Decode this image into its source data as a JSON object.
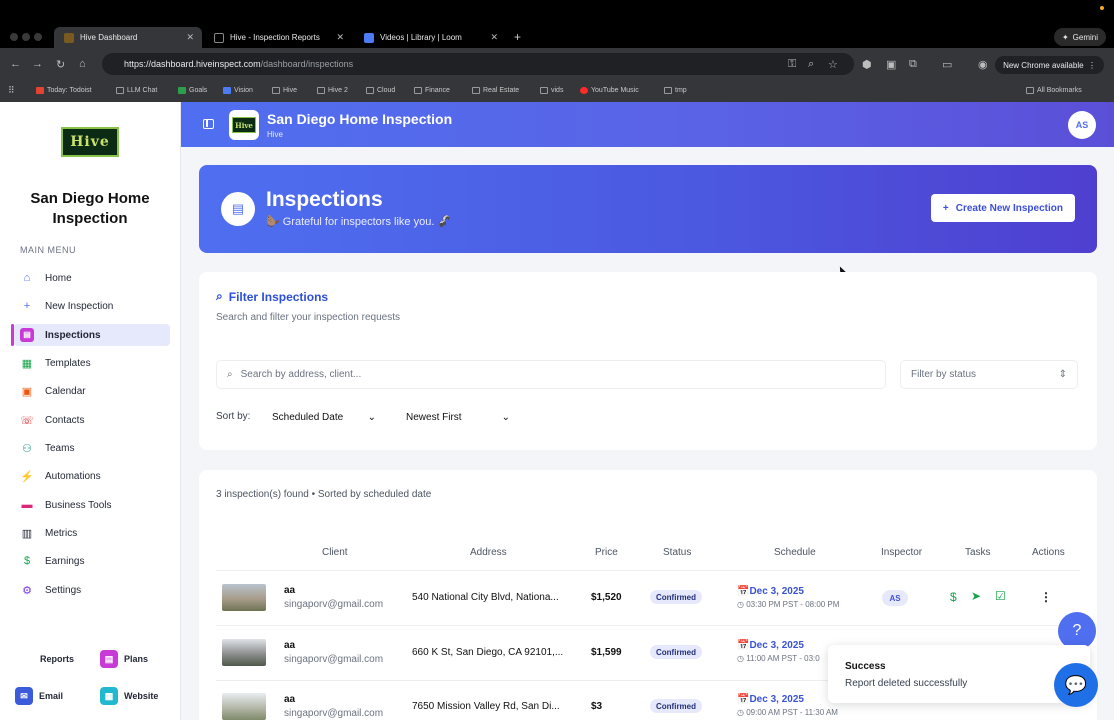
{
  "browser": {
    "tabs": [
      {
        "label": "Hive Dashboard",
        "active": true
      },
      {
        "label": "Hive - Inspection Reports",
        "active": false
      },
      {
        "label": "Videos | Library | Loom",
        "active": false
      }
    ],
    "url_host": "https://dashboard.hiveinspect.com",
    "url_path": "/dashboard/inspections",
    "gemini_label": "Gemini",
    "new_chrome_label": "New Chrome available",
    "bookmarks": [
      "Today: Todoist",
      "LLM Chat",
      "Goals",
      "Vision",
      "Hive",
      "Hive 2",
      "Cloud",
      "Finance",
      "Real Estate",
      "vids",
      "YouTube Music",
      "tmp"
    ],
    "all_bookmarks": "All Bookmarks"
  },
  "sidebar": {
    "logo_text": "Hive",
    "company": "San Diego Home Inspection",
    "menu_title": "MAIN MENU",
    "items": [
      {
        "label": "Home",
        "icon": "home-icon"
      },
      {
        "label": "New Inspection",
        "icon": "plus-icon"
      },
      {
        "label": "Inspections",
        "icon": "document-icon",
        "active": true
      },
      {
        "label": "Templates",
        "icon": "template-icon"
      },
      {
        "label": "Calendar",
        "icon": "calendar-icon"
      },
      {
        "label": "Contacts",
        "icon": "contacts-icon"
      },
      {
        "label": "Teams",
        "icon": "teams-icon"
      },
      {
        "label": "Automations",
        "icon": "lightning-icon"
      },
      {
        "label": "Business Tools",
        "icon": "briefcase-icon"
      },
      {
        "label": "Metrics",
        "icon": "chart-icon"
      },
      {
        "label": "Earnings",
        "icon": "dollar-icon"
      },
      {
        "label": "Settings",
        "icon": "gear-icon"
      }
    ],
    "bottom": {
      "reports": "Reports",
      "plans": "Plans",
      "email": "Email",
      "website": "Website"
    }
  },
  "header": {
    "title": "San Diego Home Inspection",
    "subtitle": "Hive",
    "avatar": "AS"
  },
  "banner": {
    "title": "Inspections",
    "subtitle": "🦫 Grateful for inspectors like you. 🦨",
    "create_button": "Create New Inspection"
  },
  "filter": {
    "title": "Filter Inspections",
    "subtitle": "Search and filter your inspection requests",
    "search_placeholder": "Search by address, client...",
    "status_placeholder": "Filter by status",
    "sort_label": "Sort by:",
    "sort_field": "Scheduled Date",
    "sort_order": "Newest First"
  },
  "results": {
    "count_text": "3 inspection(s) found • Sorted by scheduled date",
    "columns": [
      "Client",
      "Address",
      "Price",
      "Status",
      "Schedule",
      "Inspector",
      "Tasks",
      "Actions"
    ],
    "rows": [
      {
        "client": "aa",
        "email": "singaporv@gmail.com",
        "address": "540 National City Blvd, Nationa...",
        "price": "$1,520",
        "status": "Confirmed",
        "date": "Dec 3, 2025",
        "time": "03:30 PM PST - 08:00 PM",
        "inspector": "AS"
      },
      {
        "client": "aa",
        "email": "singaporv@gmail.com",
        "address": "660 K St, San Diego, CA 92101,...",
        "price": "$1,599",
        "status": "Confirmed",
        "date": "Dec 3, 2025",
        "time": "11:00 AM PST - 03:0",
        "inspector": ""
      },
      {
        "client": "aa",
        "email": "singaporv@gmail.com",
        "address": "7650 Mission Valley Rd, San Di...",
        "price": "$3",
        "status": "Confirmed",
        "date": "Dec 3, 2025",
        "time": "09:00 AM PST - 11:30 AM",
        "inspector": ""
      }
    ]
  },
  "toast": {
    "title": "Success",
    "message": "Report deleted successfully"
  },
  "colors": {
    "brand": "#4f6ff0",
    "accent": "#c73ad6",
    "task_green": "#16a34a"
  }
}
